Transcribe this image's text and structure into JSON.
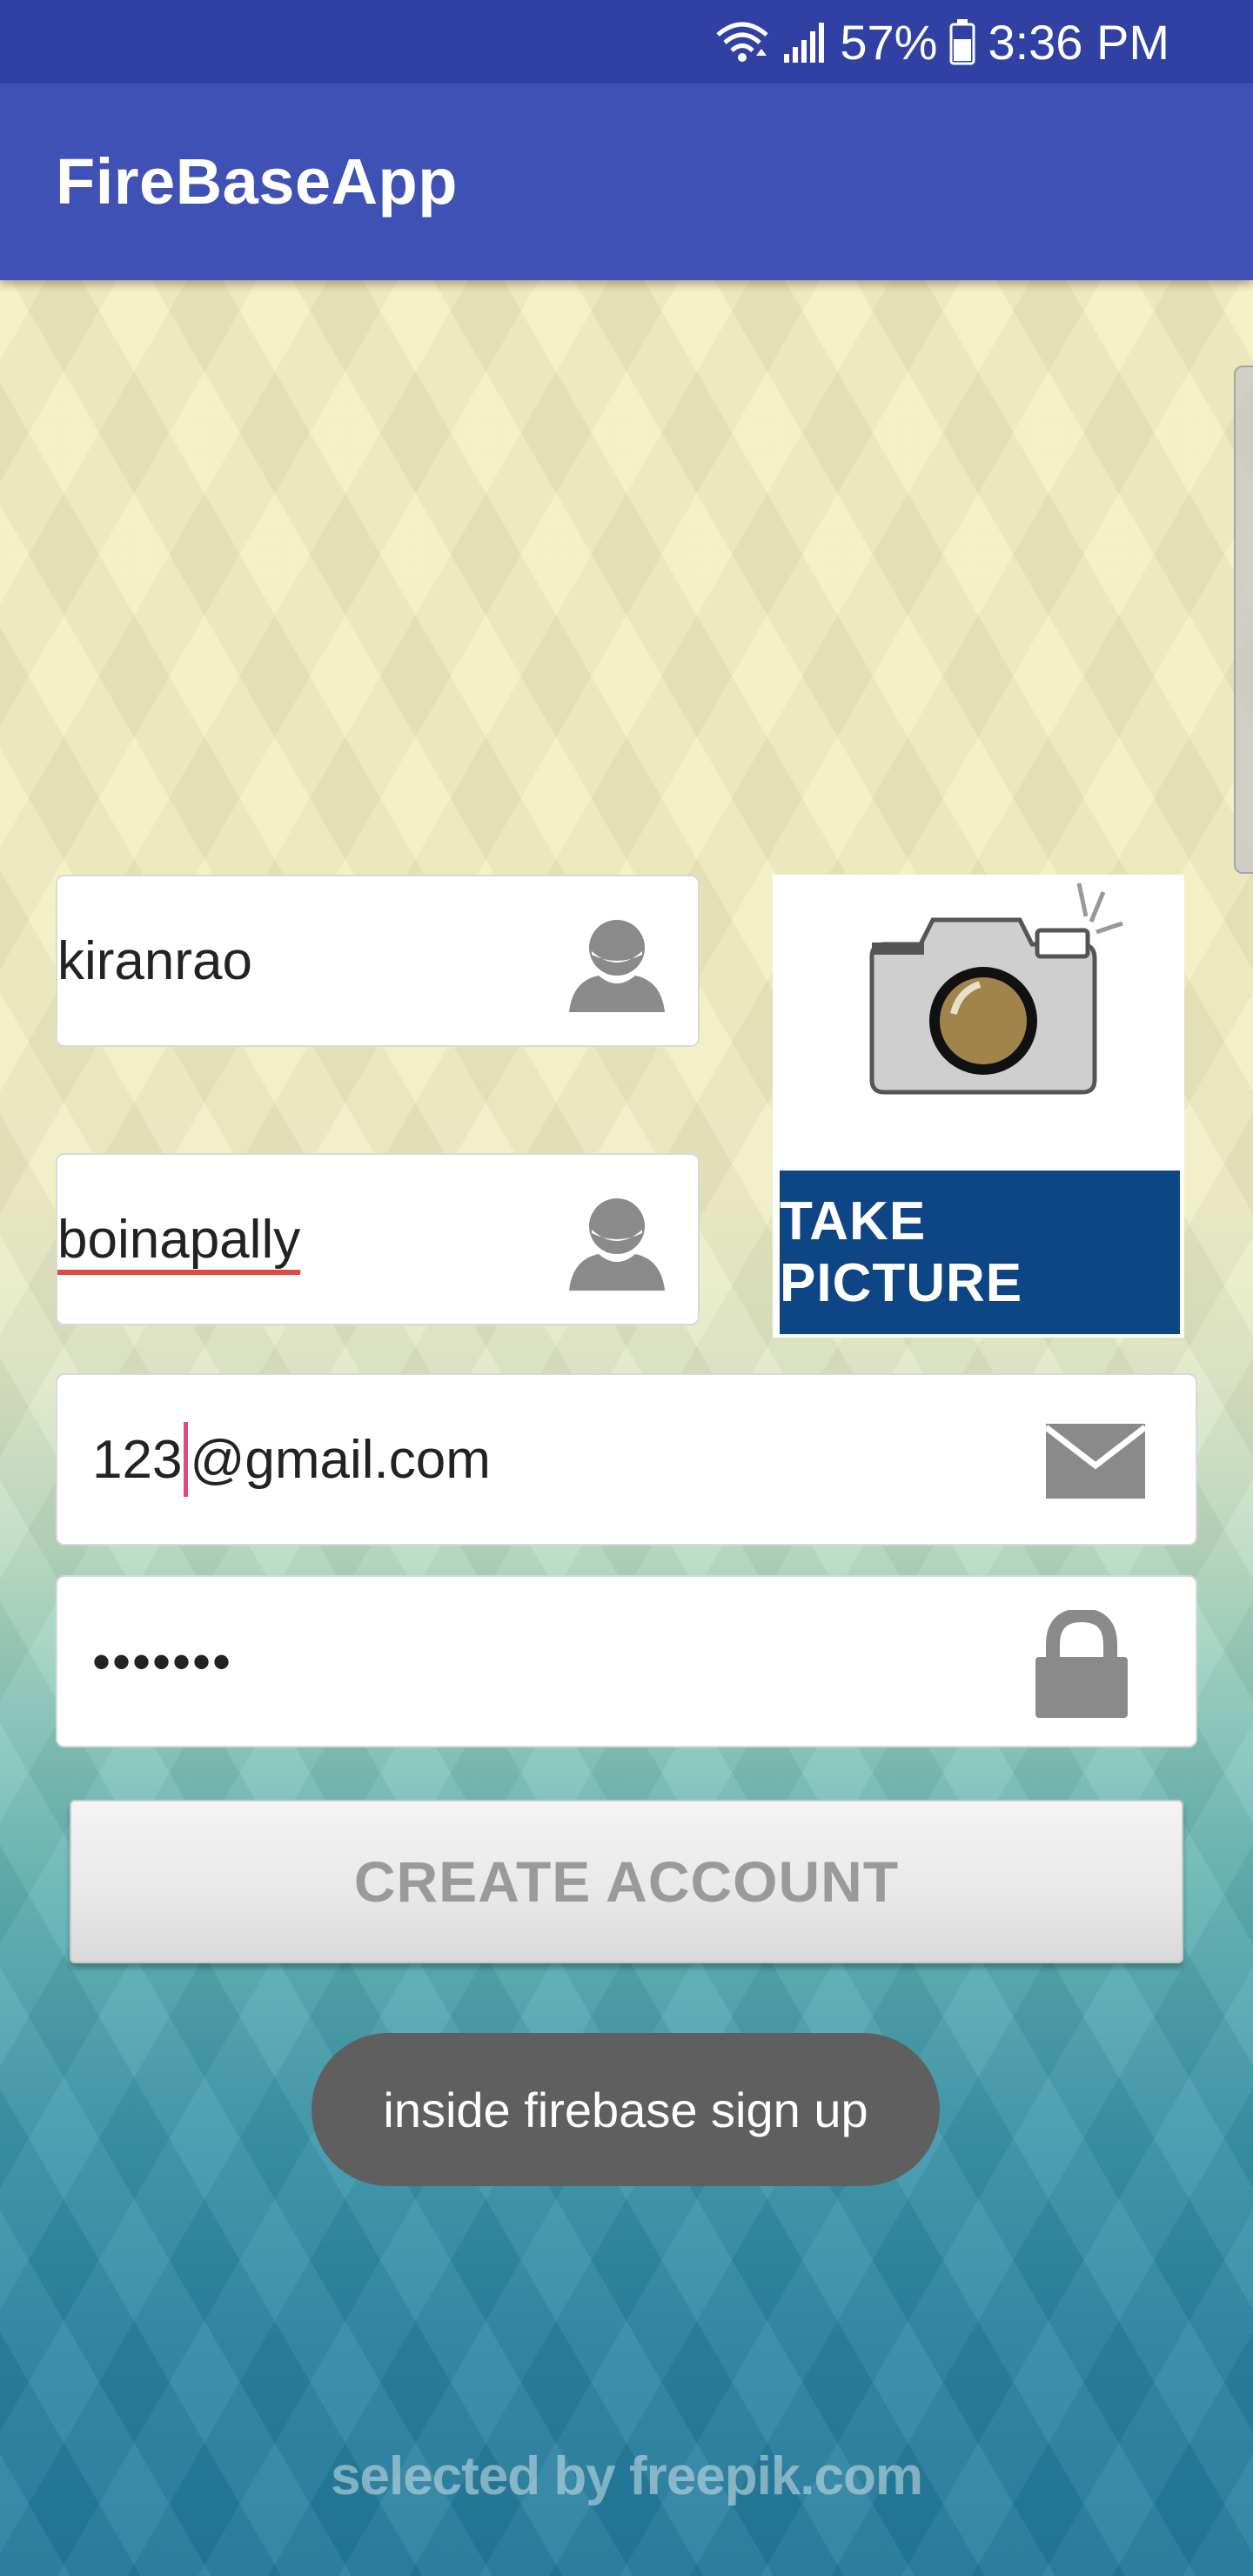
{
  "status_bar": {
    "battery_percent": "57%",
    "time": "3:36 PM"
  },
  "app_bar": {
    "title": "FireBaseApp"
  },
  "form": {
    "first_name": "kiranrao",
    "last_name": "boinapally",
    "email_before_caret": "123",
    "email_after_caret": "@gmail.com",
    "password_masked": "•••••••",
    "take_picture_label": "TAKE PICTURE",
    "create_account_label": "CREATE ACCOUNT"
  },
  "toast": {
    "message": "inside firebase sign up"
  },
  "background": {
    "watermark": "selected by freepik.com"
  },
  "colors": {
    "status_bar": "#3141a3",
    "app_bar": "#3f51b5",
    "take_picture_bg": "#0e4584",
    "toast_bg": "#5f5f5f",
    "icon_gray": "#8a8a8a"
  },
  "icons": [
    "wifi-icon",
    "signal-icon",
    "battery-icon",
    "person-icon",
    "envelope-icon",
    "lock-icon",
    "camera-icon"
  ]
}
